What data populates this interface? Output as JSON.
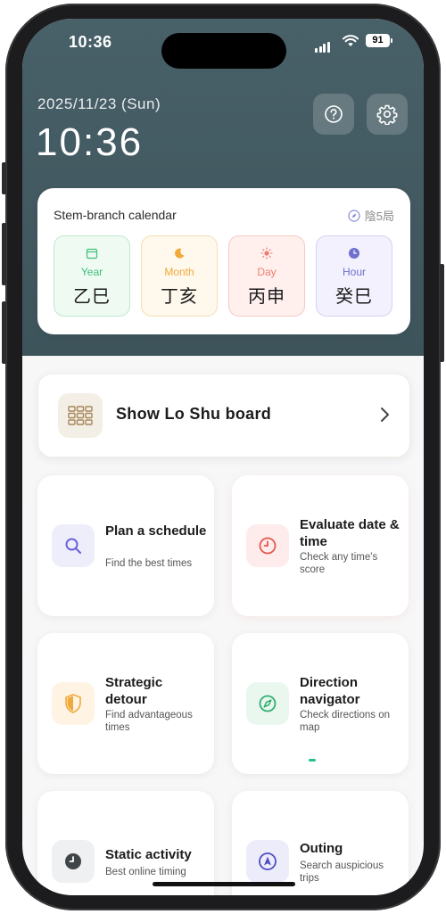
{
  "status_bar": {
    "time": "10:36",
    "battery": "91"
  },
  "header": {
    "date": "2025/11/23 (Sun)",
    "clock": "10:36"
  },
  "calendar": {
    "title": "Stem-branch calendar",
    "badge": "陰5局",
    "pillars": [
      {
        "label": "Year",
        "value": "乙巳",
        "color": "#3fbf7a",
        "bg": "#eefaf2",
        "border": "#bfe9cf"
      },
      {
        "label": "Month",
        "value": "丁亥",
        "color": "#f0a93b",
        "bg": "#fff8ec",
        "border": "#f7dfb4"
      },
      {
        "label": "Day",
        "value": "丙申",
        "color": "#ef7b6f",
        "bg": "#fff0ee",
        "border": "#f6c9c3"
      },
      {
        "label": "Hour",
        "value": "癸巳",
        "color": "#6f6fcf",
        "bg": "#f2f1fd",
        "border": "#d4d2f3"
      }
    ]
  },
  "loshu": {
    "label": "Show Lo Shu board"
  },
  "tiles": [
    {
      "title": "Plan a schedule",
      "subtitle": "Find the best times",
      "icon": "search-icon"
    },
    {
      "title": "Evaluate date & time",
      "subtitle": "Check any time's score",
      "icon": "clock-icon"
    },
    {
      "title": "Strategic detour",
      "subtitle": "Find advantageous times",
      "icon": "shield-icon"
    },
    {
      "title": "Direction navigator",
      "subtitle": "Check directions on map",
      "icon": "compass-icon"
    },
    {
      "title": "Static activity",
      "subtitle": "Best online timing",
      "icon": "clock-icon"
    },
    {
      "title": "Outing",
      "subtitle": "Search auspicious trips",
      "icon": "navigation-arrow-icon"
    }
  ]
}
